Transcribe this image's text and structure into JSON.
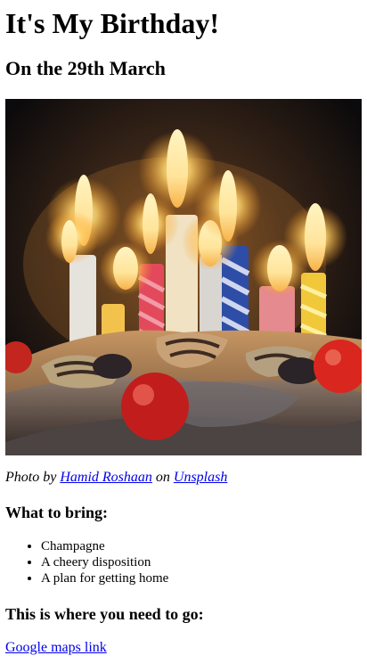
{
  "page": {
    "title": "It's My Birthday!",
    "subtitle": "On the 29th March"
  },
  "photo": {
    "alt": "Birthday cake with lit candles"
  },
  "credit": {
    "prefix": "Photo by ",
    "author": "Hamid Roshaan",
    "middle": " on ",
    "site": "Unsplash"
  },
  "bring": {
    "heading": "What to bring:",
    "items": [
      "Champagne",
      "A cheery disposition",
      "A plan for getting home"
    ]
  },
  "go": {
    "heading": "This is where you need to go:",
    "link": "Google maps link"
  },
  "colors": {
    "link": "#0000ee",
    "text": "#000000",
    "background": "#ffffff"
  }
}
